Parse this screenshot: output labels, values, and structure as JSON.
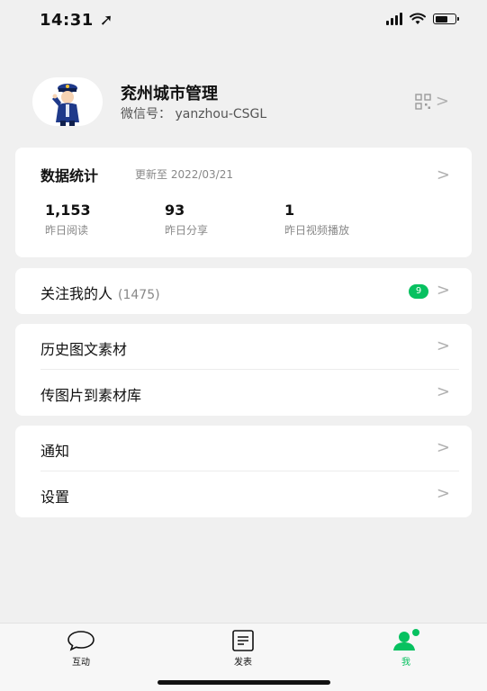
{
  "status_bar": {
    "time": "14:31 ➚"
  },
  "profile": {
    "name": "兖州城市管理",
    "wechat_id": "微信号： yanzhou-CSGL",
    "qr_icon": "qr-code-icon",
    "chevron": ">"
  },
  "stats": {
    "title": "数据统计",
    "updated": "更新至 2022/03/21",
    "chevron": ">",
    "items": [
      {
        "value": "1,153",
        "label": "昨日阅读"
      },
      {
        "value": "93",
        "label": "昨日分享"
      },
      {
        "value": "1",
        "label": "昨日视频播放"
      }
    ]
  },
  "followers": {
    "label": "关注我的人",
    "count": "(1475)",
    "badge": "9",
    "chevron": ">"
  },
  "materials": {
    "items": [
      {
        "label": "历史图文素材",
        "chevron": ">"
      },
      {
        "label": "传图片到素材库",
        "chevron": ">"
      }
    ]
  },
  "settings_group": {
    "items": [
      {
        "label": "通知",
        "chevron": ">"
      },
      {
        "label": "设置",
        "chevron": ">"
      }
    ]
  },
  "tabbar": {
    "tabs": [
      {
        "label": "互动",
        "icon": "chat-bubble-icon"
      },
      {
        "label": "发表",
        "icon": "document-icon"
      },
      {
        "label": "我",
        "icon": "person-icon",
        "active": true
      }
    ]
  },
  "colors": {
    "accent": "#07c160",
    "background": "#f0f0f0"
  }
}
